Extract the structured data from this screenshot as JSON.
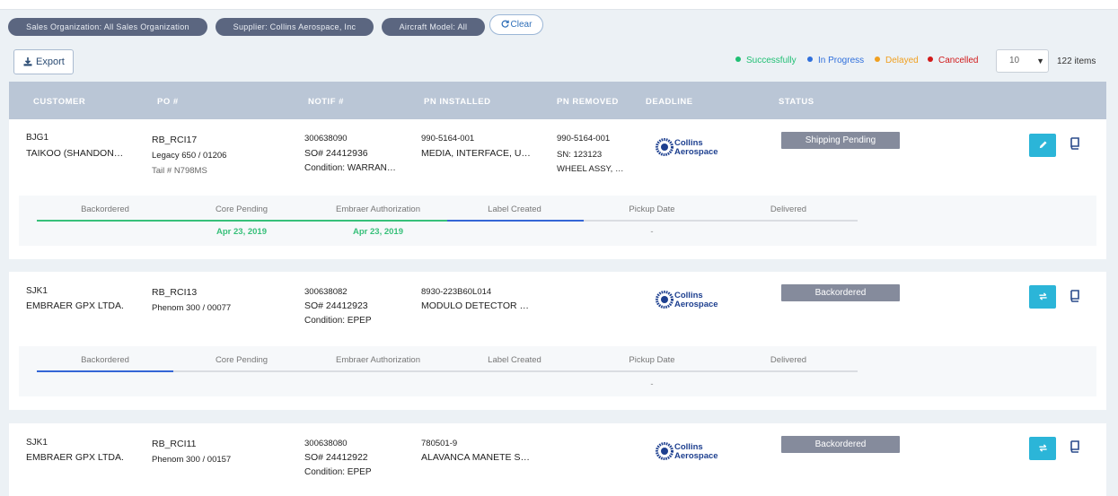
{
  "filters": [
    {
      "label": "Sales Organization: All Sales Organization"
    },
    {
      "label": "Supplier: Collins Aerospace, Inc"
    },
    {
      "label": "Aircraft Model: All"
    }
  ],
  "clear_label": "Clear",
  "export_label": "Export",
  "legend": [
    {
      "label": "Successfully",
      "color": "#1fbf73"
    },
    {
      "label": "In Progress",
      "color": "#2f6fdc"
    },
    {
      "label": "Delayed",
      "color": "#f0a020"
    },
    {
      "label": "Cancelled",
      "color": "#d11a1a"
    }
  ],
  "page_size": "10",
  "items_count": "122 items",
  "columns": [
    "CUSTOMER",
    "PO #",
    "NOTIF #",
    "PN INSTALLED",
    "PN REMOVED",
    "DEADLINE",
    "STATUS"
  ],
  "supplier_logo": {
    "line1": "Collins",
    "line2": "Aerospace"
  },
  "rows": [
    {
      "customer_code": "BJG1",
      "customer_name": "TAIKOO (SHANDON…",
      "po": "RB_RCI17",
      "po_detail": "Legacy 650 / 01206",
      "po_tail": "Tail # N798MS",
      "notif": "300638090",
      "so": "SO# 24412936",
      "condition": "Condition: WARRAN…",
      "pn_installed": "990-5164-001",
      "pn_installed_desc": "MEDIA, INTERFACE, U…",
      "pn_removed": "990-5164-001",
      "pn_removed_sn": "SN: 123123",
      "pn_removed_desc": "WHEEL ASSY, …",
      "status": "Shipping Pending",
      "steps": [
        "Backordered",
        "Core Pending",
        "Embraer Authorization",
        "Label Created",
        "Pickup Date",
        "Delivered"
      ],
      "step_dates": [
        "",
        "Apr 23, 2019",
        "Apr 23, 2019",
        "",
        "-",
        ""
      ]
    },
    {
      "customer_code": "SJK1",
      "customer_name": "EMBRAER GPX LTDA.",
      "po": "RB_RCI13",
      "po_detail": "Phenom 300 / 00077",
      "notif": "300638082",
      "so": "SO# 24412923",
      "condition": "Condition: EPEP",
      "pn_installed": "8930-223B60L014",
      "pn_installed_desc": "MODULO DETECTOR …",
      "status": "Backordered",
      "steps": [
        "Backordered",
        "Core Pending",
        "Embraer Authorization",
        "Label Created",
        "Pickup Date",
        "Delivered"
      ],
      "step_dates": [
        "",
        "",
        "",
        "",
        "-",
        ""
      ]
    },
    {
      "customer_code": "SJK1",
      "customer_name": "EMBRAER GPX LTDA.",
      "po": "RB_RCI11",
      "po_detail": "Phenom 300 / 00157",
      "notif": "300638080",
      "so": "SO# 24412922",
      "condition": "Condition: EPEP",
      "pn_installed": "780501-9",
      "pn_installed_desc": "ALAVANCA MANETE S…",
      "status": "Backordered"
    }
  ]
}
